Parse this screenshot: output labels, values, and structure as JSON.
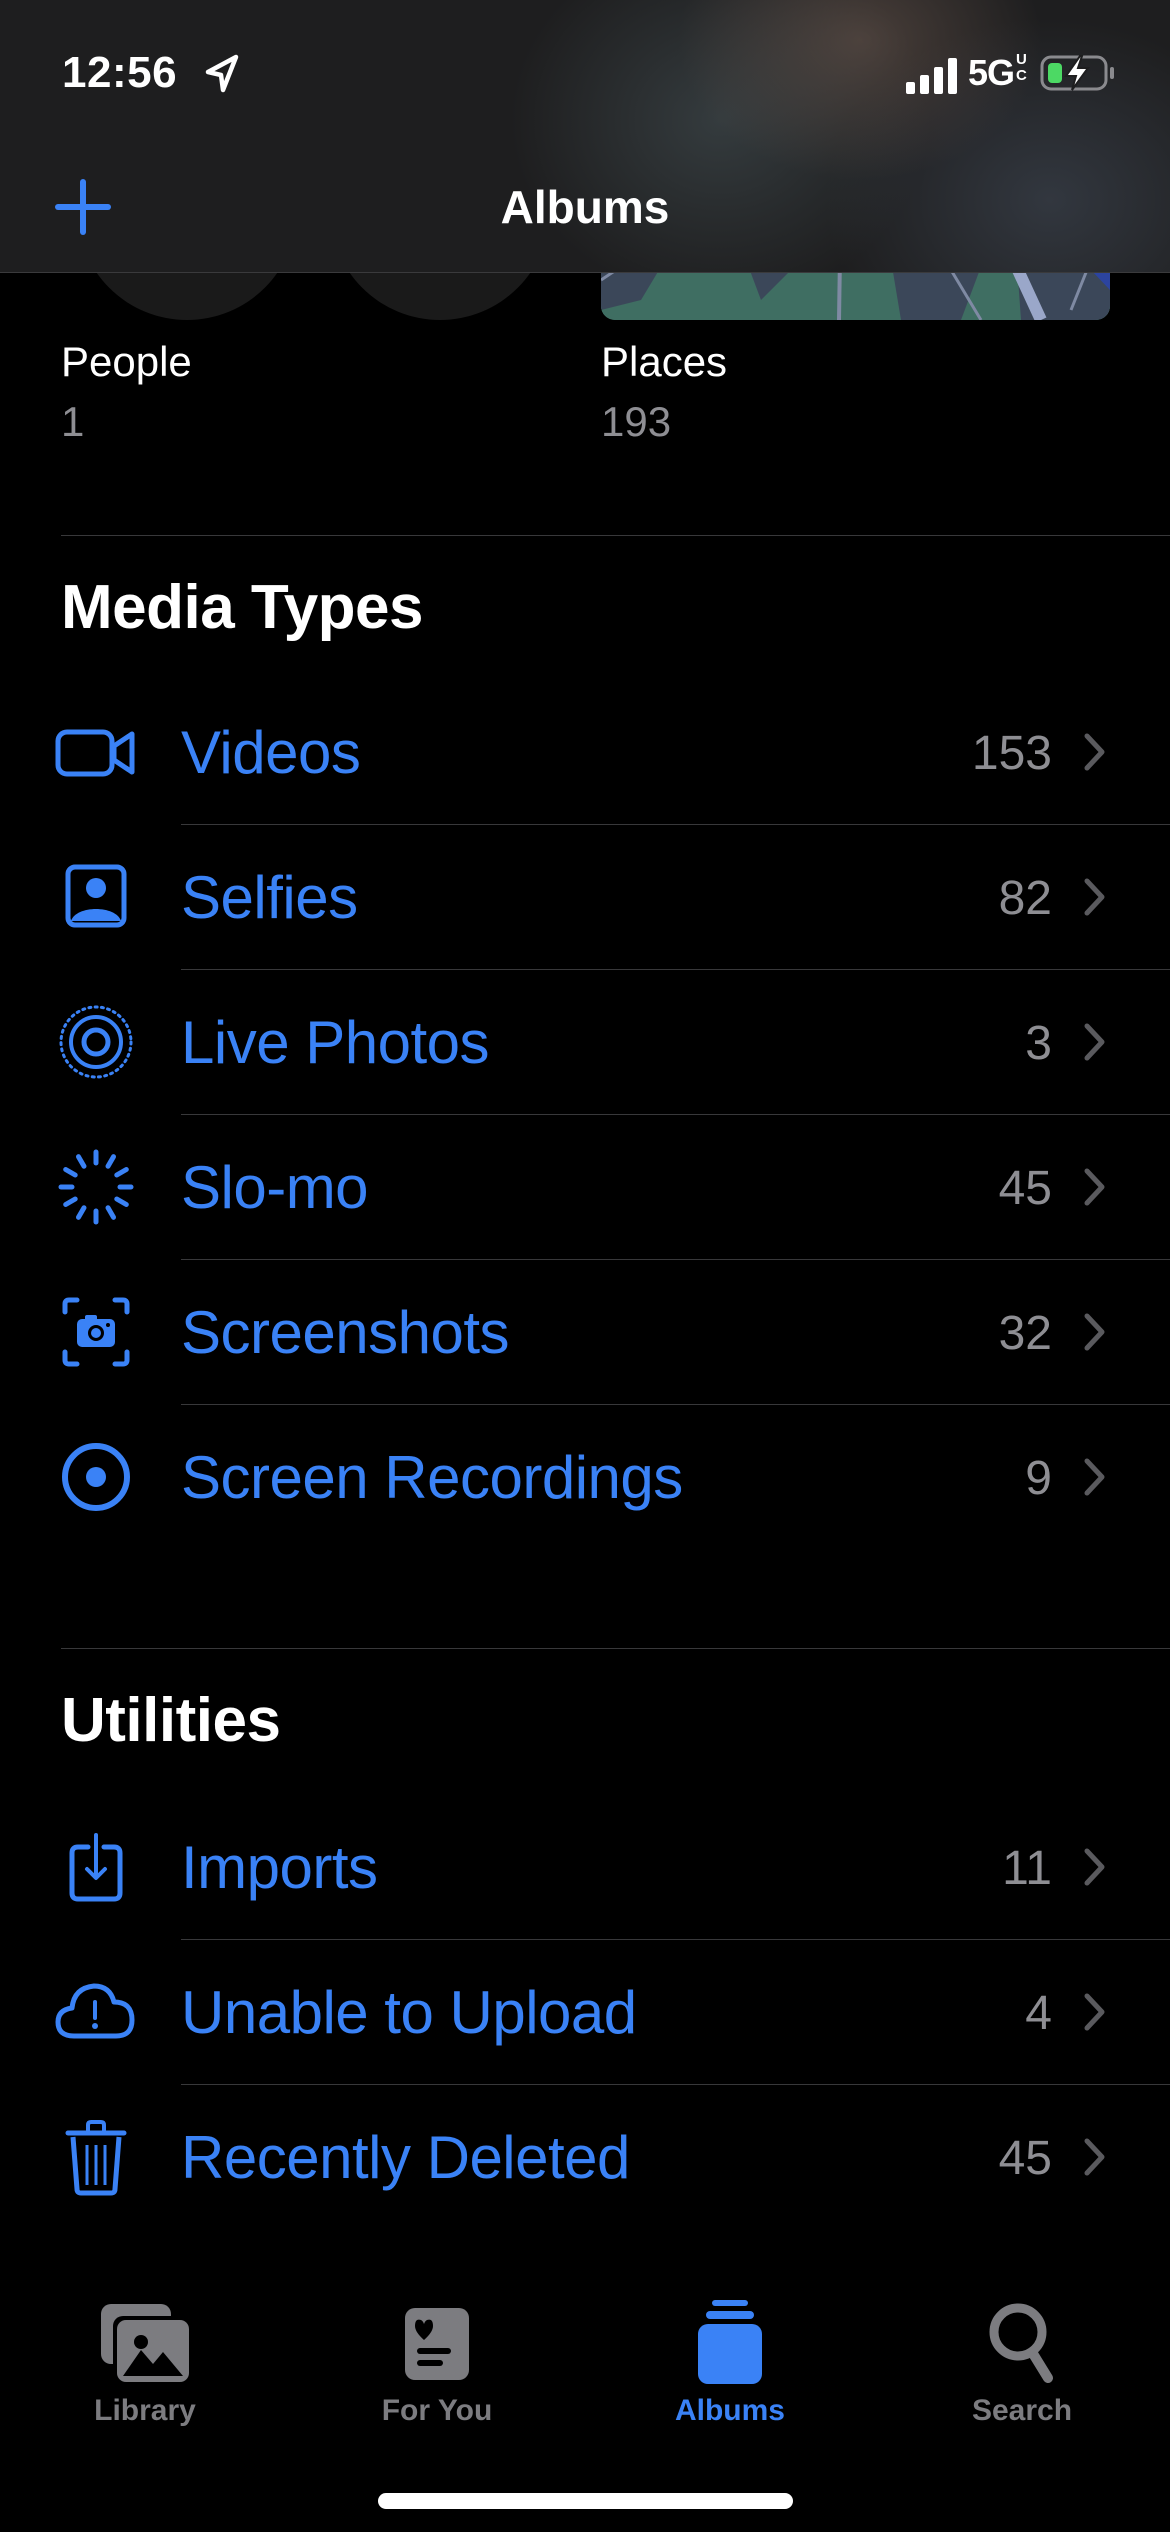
{
  "status_bar": {
    "time": "12:56",
    "network": "5G",
    "network_badge": "UC",
    "battery_charging": true
  },
  "nav": {
    "title": "Albums",
    "add_button": "add-album"
  },
  "people_places": [
    {
      "label": "People",
      "count": "1"
    },
    {
      "label": "Places",
      "count": "193"
    }
  ],
  "sections": {
    "media_types": {
      "title": "Media Types",
      "items": [
        {
          "label": "Videos",
          "count": "153",
          "icon": "video-camera-icon"
        },
        {
          "label": "Selfies",
          "count": "82",
          "icon": "selfie-portrait-icon"
        },
        {
          "label": "Live Photos",
          "count": "3",
          "icon": "live-photo-icon"
        },
        {
          "label": "Slo-mo",
          "count": "45",
          "icon": "slo-mo-icon"
        },
        {
          "label": "Screenshots",
          "count": "32",
          "icon": "screenshot-camera-icon"
        },
        {
          "label": "Screen Recordings",
          "count": "9",
          "icon": "screen-recording-icon"
        }
      ]
    },
    "utilities": {
      "title": "Utilities",
      "items": [
        {
          "label": "Imports",
          "count": "11",
          "icon": "import-tray-icon"
        },
        {
          "label": "Unable to Upload",
          "count": "4",
          "icon": "cloud-exclamation-icon"
        },
        {
          "label": "Recently Deleted",
          "count": "45",
          "icon": "trash-icon"
        }
      ]
    }
  },
  "tabbar": {
    "tabs": [
      {
        "label": "Library",
        "icon": "photo-stack-icon",
        "active": false
      },
      {
        "label": "For You",
        "icon": "for-you-heart-card-icon",
        "active": false
      },
      {
        "label": "Albums",
        "icon": "albums-stack-icon",
        "active": true
      },
      {
        "label": "Search",
        "icon": "magnifying-glass-icon",
        "active": false
      }
    ]
  },
  "colors": {
    "accent": "#3A82F6",
    "secondary_text": "#8E8E93",
    "separator": "#38383A",
    "background": "#000000",
    "battery_fill": "#4CD964"
  }
}
